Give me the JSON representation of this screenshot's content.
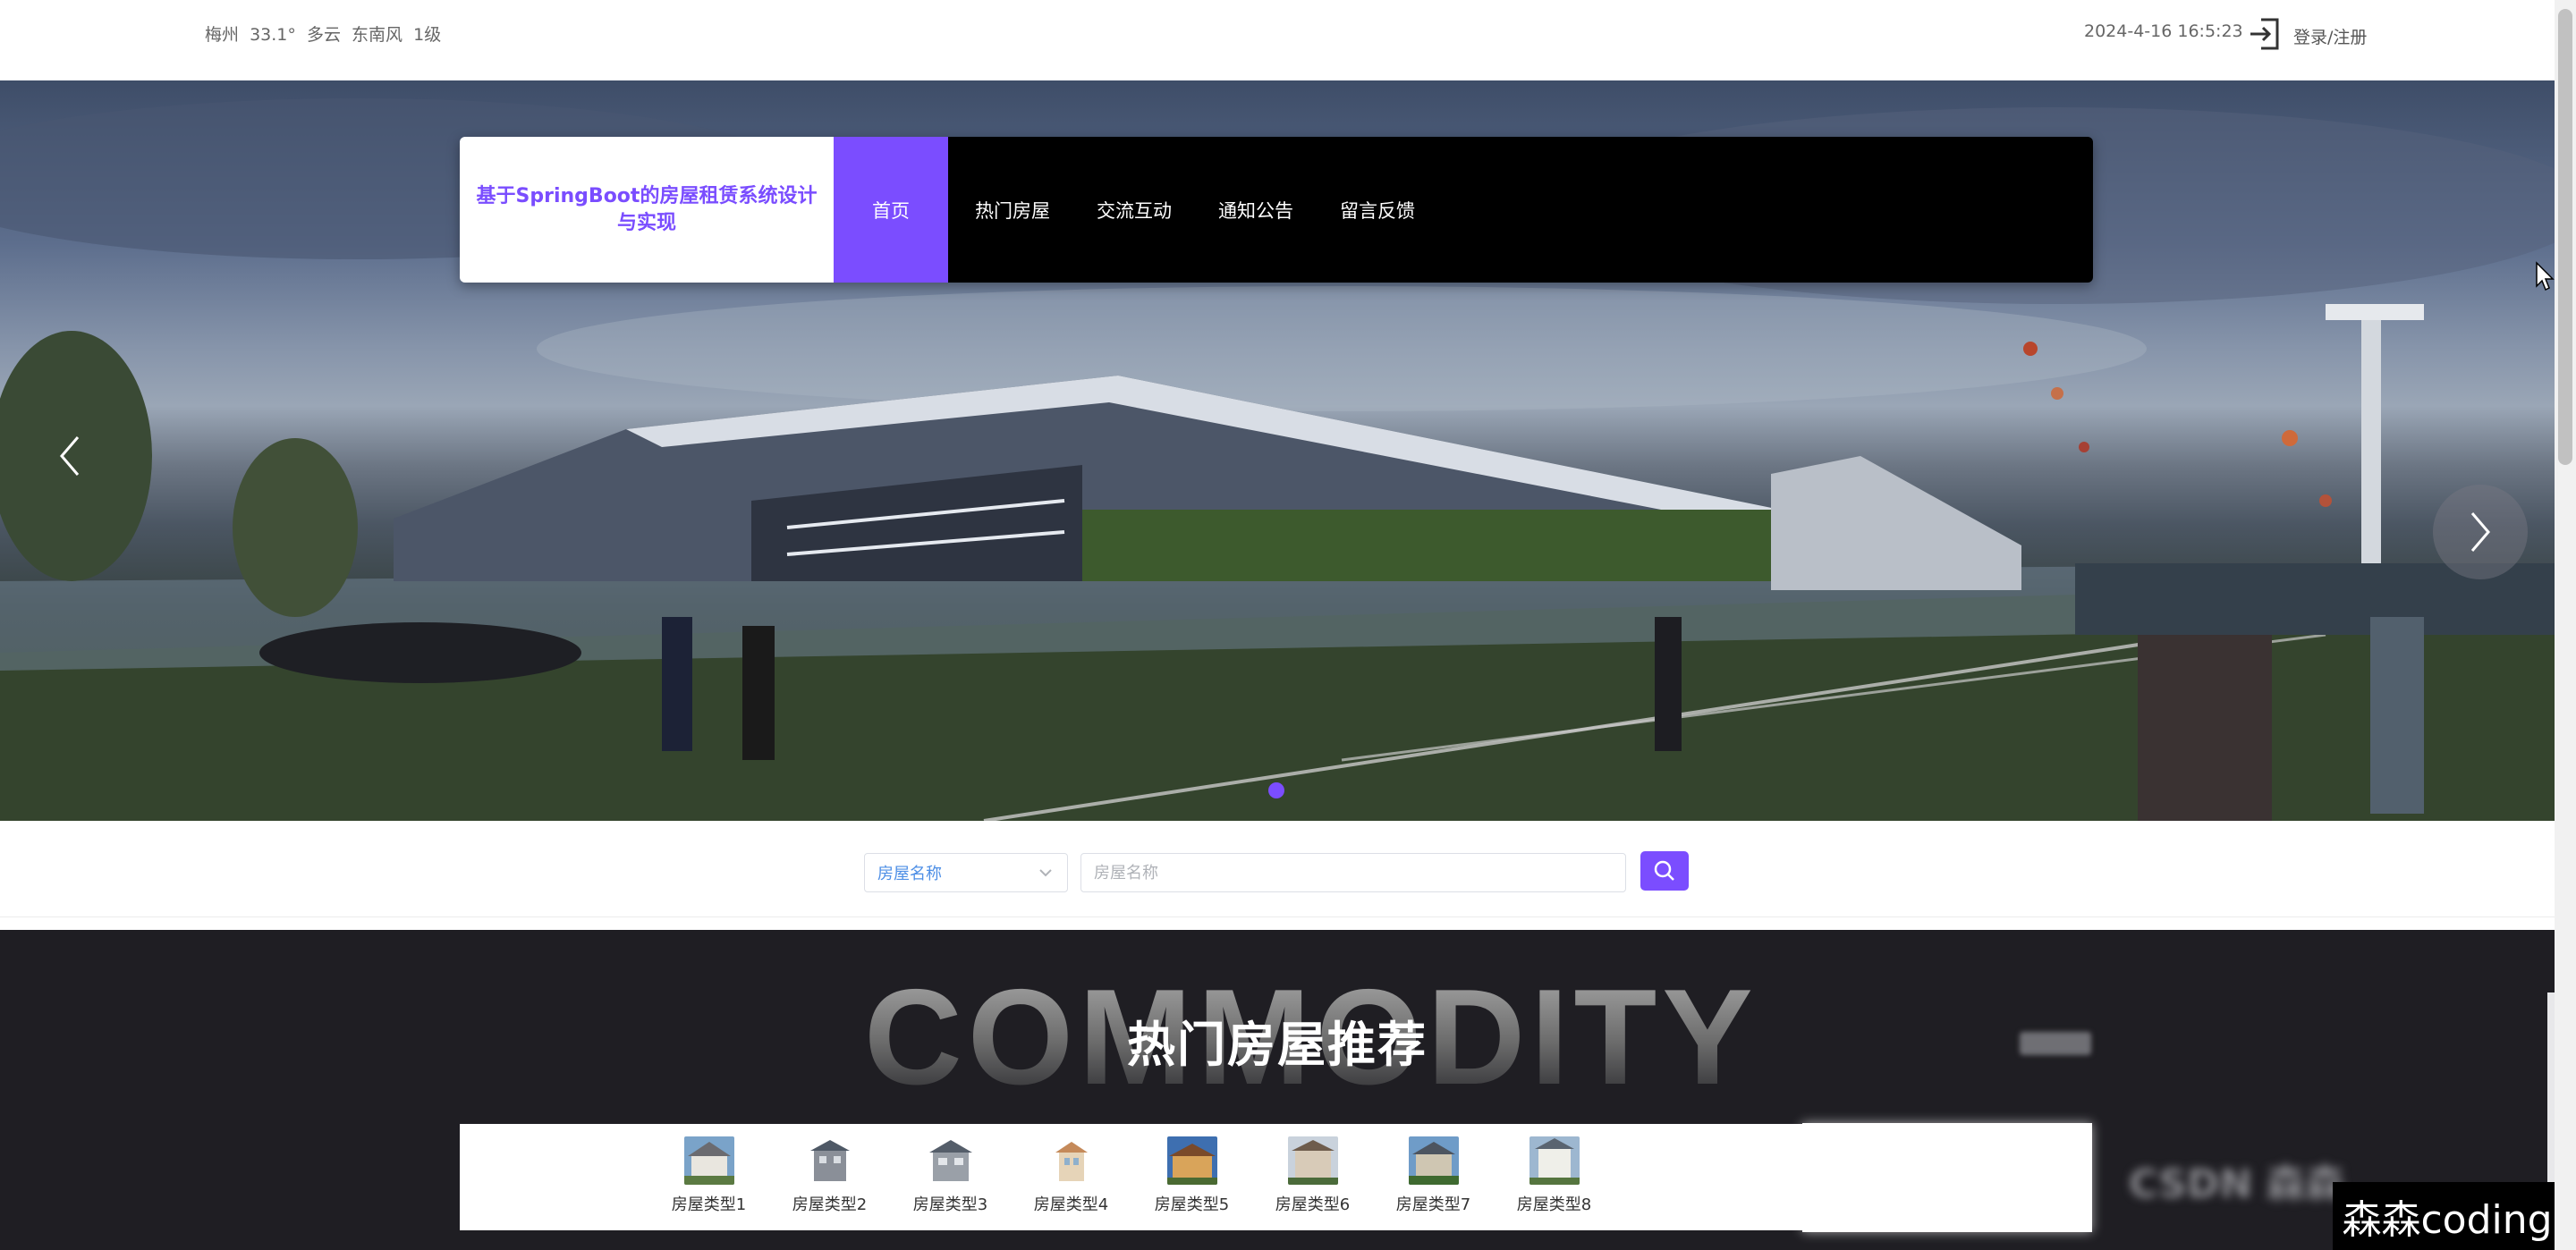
{
  "topbar": {
    "weather": "梅州  33.1°  多云  东南风  1级",
    "datetime": "2024-4-16 16:5:23",
    "login_label": "登录/注册"
  },
  "nav": {
    "brand_title": "基于SpringBoot的房屋租赁系统设计与实现",
    "items": [
      {
        "label": "首页",
        "active": true
      },
      {
        "label": "热门房屋",
        "active": false
      },
      {
        "label": "交流互动",
        "active": false
      },
      {
        "label": "通知公告",
        "active": false
      },
      {
        "label": "留言反馈",
        "active": false
      }
    ]
  },
  "search": {
    "select_value": "房屋名称",
    "input_placeholder": "房屋名称",
    "input_value": ""
  },
  "section": {
    "bg_word": "COMMODITY",
    "title": "热门房屋推荐"
  },
  "house_types": [
    {
      "label": "房屋类型1"
    },
    {
      "label": "房屋类型2"
    },
    {
      "label": "房屋类型3"
    },
    {
      "label": "房屋类型4"
    },
    {
      "label": "房屋类型5"
    },
    {
      "label": "房屋类型6"
    },
    {
      "label": "房屋类型7"
    },
    {
      "label": "房屋类型8"
    }
  ],
  "blurred_overlay_text": "CSDN 森森",
  "watermark": "森森coding",
  "colors": {
    "accent": "#7b4dff",
    "dark_bg": "#1f1e23",
    "nav_bg": "#000000"
  },
  "icons": [
    "login-icon",
    "chevron-left-icon",
    "chevron-right-icon",
    "chevron-down-icon",
    "search-icon",
    "cursor-icon"
  ]
}
